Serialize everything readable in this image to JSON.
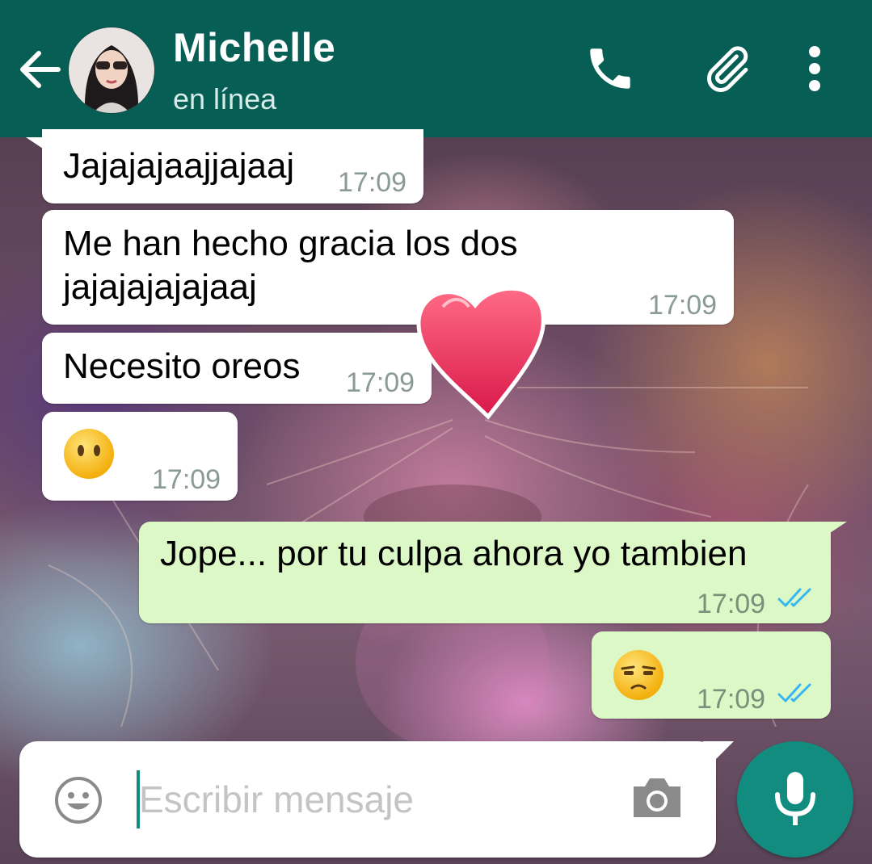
{
  "header": {
    "contact_name": "Michelle",
    "status": "en línea"
  },
  "messages": [
    {
      "direction": "in",
      "text": "Jajajajaajjajaaj",
      "time": "17:09"
    },
    {
      "direction": "in",
      "text_line1": "Me han hecho gracia los dos",
      "text_line2": "jajajajajajaaj",
      "time": "17:09"
    },
    {
      "direction": "in",
      "text": "Necesito oreos",
      "time": "17:09"
    },
    {
      "direction": "in",
      "emoji": "neutral-face-emoji",
      "time": "17:09"
    },
    {
      "direction": "out",
      "text": "Jope... por tu culpa ahora yo tambien",
      "time": "17:09",
      "status": "read"
    },
    {
      "direction": "out",
      "emoji": "unamused-face-emoji",
      "time": "17:09",
      "status": "read"
    }
  ],
  "sticker": "red-heart-sticker",
  "input": {
    "placeholder": "Escribir mensaje",
    "value": ""
  },
  "colors": {
    "header": "#075e54",
    "accent": "#128c7e",
    "outgoing_bubble": "#dcf8c6",
    "incoming_bubble": "#ffffff",
    "read_ticks": "#34b7f1"
  },
  "icons": [
    "back-arrow-icon",
    "phone-icon",
    "paperclip-icon",
    "more-vert-icon",
    "smiley-icon",
    "camera-icon",
    "microphone-icon"
  ]
}
